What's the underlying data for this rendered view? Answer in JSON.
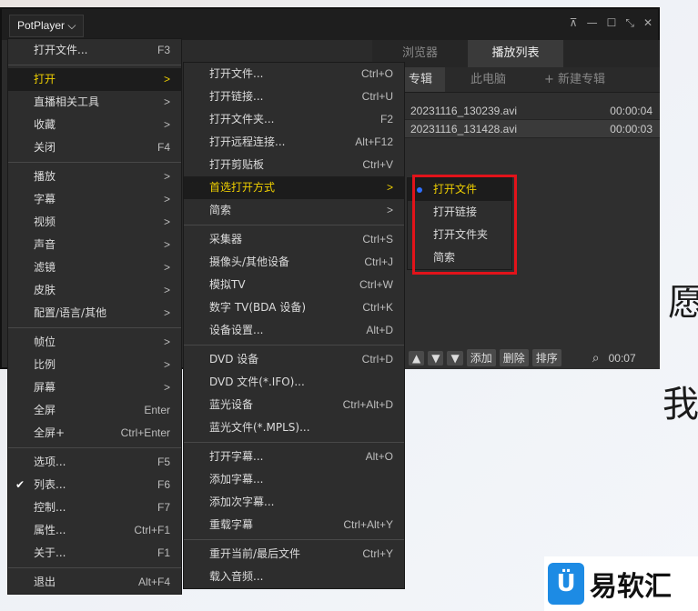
{
  "player": {
    "brand": "PotPlayer ⌵",
    "window_buttons": [
      "⊼",
      "—",
      "☐",
      "⤡",
      "✕"
    ],
    "tabs": [
      "浏览器",
      "播放列表"
    ],
    "subtabs": [
      "专辑",
      "此电脑",
      "+ 新建专辑"
    ],
    "files": [
      {
        "name": "20231116_130239.avi",
        "duration": "00:00:04"
      },
      {
        "name": "20231116_131428.avi",
        "duration": "00:00:03"
      }
    ],
    "bottom_buttons": [
      "▲",
      "▼",
      "▼",
      "添加",
      "删除",
      "排序"
    ],
    "time": "00:07"
  },
  "main_menu": [
    {
      "label": "打开文件...",
      "shortcut": "F3"
    },
    {
      "sep": true
    },
    {
      "label": "打开",
      "shortcut": ">",
      "active": true
    },
    {
      "label": "直播相关工具",
      "shortcut": ">"
    },
    {
      "label": "收藏",
      "shortcut": ">"
    },
    {
      "label": "关闭",
      "shortcut": "F4"
    },
    {
      "sep": true
    },
    {
      "label": "播放",
      "shortcut": ">"
    },
    {
      "label": "字幕",
      "shortcut": ">"
    },
    {
      "label": "视频",
      "shortcut": ">"
    },
    {
      "label": "声音",
      "shortcut": ">"
    },
    {
      "label": "滤镜",
      "shortcut": ">"
    },
    {
      "label": "皮肤",
      "shortcut": ">"
    },
    {
      "label": "配置/语言/其他",
      "shortcut": ">"
    },
    {
      "sep": true
    },
    {
      "label": "帧位",
      "shortcut": ">"
    },
    {
      "label": "比例",
      "shortcut": ">"
    },
    {
      "label": "屏幕",
      "shortcut": ">"
    },
    {
      "label": "全屏",
      "shortcut": "Enter"
    },
    {
      "label": "全屏+",
      "shortcut": "Ctrl+Enter"
    },
    {
      "sep": true
    },
    {
      "label": "选项...",
      "shortcut": "F5"
    },
    {
      "label": "列表...",
      "shortcut": "F6",
      "checked": true
    },
    {
      "label": "控制...",
      "shortcut": "F7"
    },
    {
      "label": "属性...",
      "shortcut": "Ctrl+F1"
    },
    {
      "label": "关于...",
      "shortcut": "F1"
    },
    {
      "sep": true
    },
    {
      "label": "退出",
      "shortcut": "Alt+F4"
    }
  ],
  "open_menu": [
    {
      "label": "打开文件...",
      "shortcut": "Ctrl+O"
    },
    {
      "label": "打开链接...",
      "shortcut": "Ctrl+U"
    },
    {
      "label": "打开文件夹...",
      "shortcut": "F2"
    },
    {
      "label": "打开远程连接...",
      "shortcut": "Alt+F12"
    },
    {
      "label": "打开剪贴板",
      "shortcut": "Ctrl+V"
    },
    {
      "label": "首选打开方式",
      "shortcut": ">",
      "highlight": true
    },
    {
      "label": "简索",
      "shortcut": ">"
    },
    {
      "sep": true
    },
    {
      "label": "采集器",
      "shortcut": "Ctrl+S"
    },
    {
      "label": "摄像头/其他设备",
      "shortcut": "Ctrl+J"
    },
    {
      "label": "模拟TV",
      "shortcut": "Ctrl+W"
    },
    {
      "label": "数字 TV(BDA 设备)",
      "shortcut": "Ctrl+K"
    },
    {
      "label": "设备设置...",
      "shortcut": "Alt+D"
    },
    {
      "sep": true
    },
    {
      "label": "DVD 设备",
      "shortcut": "Ctrl+D"
    },
    {
      "label": "DVD 文件(*.IFO)...",
      "shortcut": ""
    },
    {
      "label": "蓝光设备",
      "shortcut": "Ctrl+Alt+D"
    },
    {
      "label": "蓝光文件(*.MPLS)...",
      "shortcut": ""
    },
    {
      "sep": true
    },
    {
      "label": "打开字幕...",
      "shortcut": "Alt+O"
    },
    {
      "label": "添加字幕...",
      "shortcut": ""
    },
    {
      "label": "添加次字幕...",
      "shortcut": ""
    },
    {
      "label": "重载字幕",
      "shortcut": "Ctrl+Alt+Y"
    },
    {
      "sep": true
    },
    {
      "label": "重开当前/最后文件",
      "shortcut": "Ctrl+Y"
    },
    {
      "label": "载入音频...",
      "shortcut": ""
    }
  ],
  "pref_menu": [
    {
      "label": "打开文件",
      "highlight": true,
      "selected": true
    },
    {
      "label": "打开链接"
    },
    {
      "label": "打开文件夹"
    },
    {
      "label": "简索"
    }
  ],
  "bg_text": [
    "愿",
    "我"
  ],
  "logo": {
    "mark": "Ü",
    "text": "易软汇"
  }
}
